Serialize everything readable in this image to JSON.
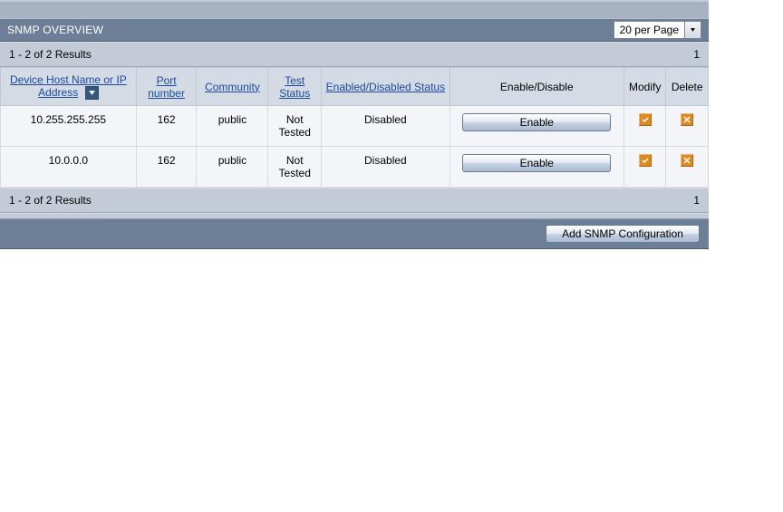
{
  "title": "SNMP OVERVIEW",
  "perpage": {
    "label": "20 per Page"
  },
  "results": {
    "label": "1 - 2 of 2 Results",
    "page": "1"
  },
  "columns": {
    "host": "Device Host Name or IP Address",
    "port": "Port number",
    "community": "Community",
    "testStatus": "Test Status",
    "enabledStatus": "Enabled/Disabled Status",
    "enableDisable": "Enable/Disable",
    "modify": "Modify",
    "delete": "Delete"
  },
  "rows": [
    {
      "host": "10.255.255.255",
      "port": "162",
      "community": "public",
      "testStatus": "Not Tested",
      "enabledStatus": "Disabled",
      "action": "Enable"
    },
    {
      "host": "10.0.0.0",
      "port": "162",
      "community": "public",
      "testStatus": "Not Tested",
      "enabledStatus": "Disabled",
      "action": "Enable"
    }
  ],
  "footer": {
    "addButton": "Add SNMP Configuration"
  }
}
